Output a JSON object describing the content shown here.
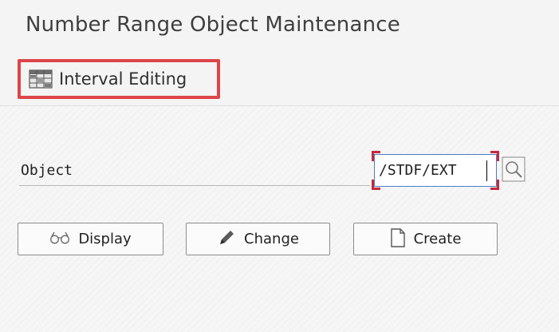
{
  "header": {
    "title": "Number Range Object Maintenance"
  },
  "toolbar": {
    "interval_editing_label": "Interval Editing",
    "interval_editing_icon": "table-grid-icon",
    "highlight_color": "#dd4548"
  },
  "form": {
    "object_label": "Object",
    "object_value": "/STDF/EXT",
    "search_help_icon": "search-help-icon"
  },
  "actions": {
    "display_label": "Display",
    "display_icon": "glasses-icon",
    "change_label": "Change",
    "change_icon": "pencil-icon",
    "create_label": "Create",
    "create_icon": "document-icon"
  }
}
